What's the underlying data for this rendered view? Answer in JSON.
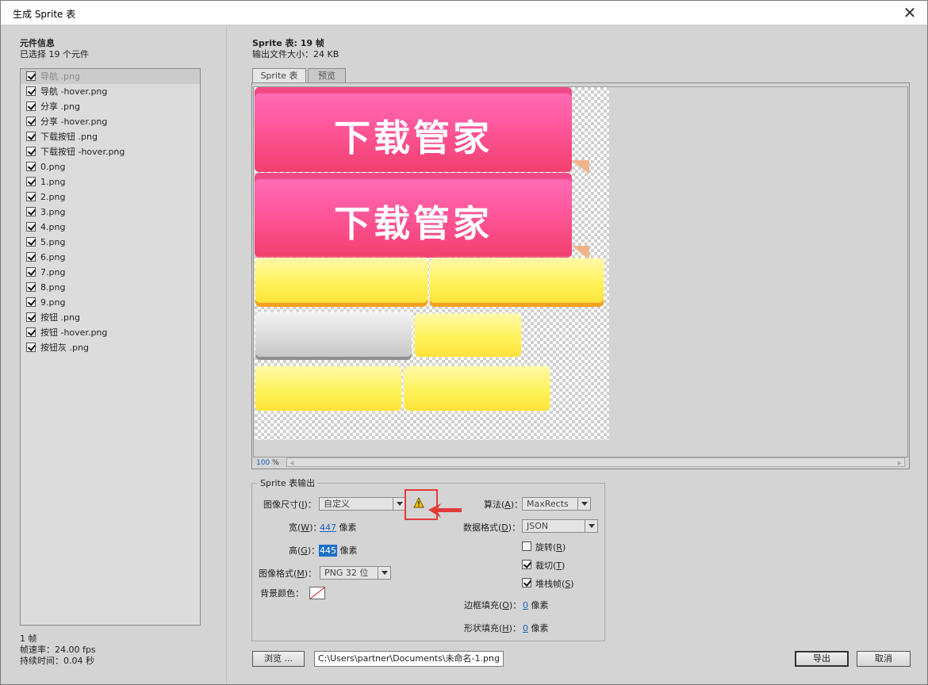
{
  "window": {
    "title": "生成 Sprite 表",
    "close_label": "✕"
  },
  "left": {
    "heading": "元件信息",
    "selected_count": "已选择 19 个元件",
    "items": [
      {
        "label": "导航 .png",
        "checked": true
      },
      {
        "label": "导航 -hover.png",
        "checked": true
      },
      {
        "label": "分享 .png",
        "checked": true
      },
      {
        "label": "分享 -hover.png",
        "checked": true
      },
      {
        "label": "下载按钮 .png",
        "checked": true
      },
      {
        "label": "下载按钮 -hover.png",
        "checked": true
      },
      {
        "label": "0.png",
        "checked": true
      },
      {
        "label": "1.png",
        "checked": true
      },
      {
        "label": "2.png",
        "checked": true
      },
      {
        "label": "3.png",
        "checked": true
      },
      {
        "label": "4.png",
        "checked": true
      },
      {
        "label": "5.png",
        "checked": true
      },
      {
        "label": "6.png",
        "checked": true
      },
      {
        "label": "7.png",
        "checked": true
      },
      {
        "label": "8.png",
        "checked": true
      },
      {
        "label": "9.png",
        "checked": true
      },
      {
        "label": "按钮 .png",
        "checked": true
      },
      {
        "label": "按钮 -hover.png",
        "checked": true
      },
      {
        "label": "按钮灰 .png",
        "checked": true
      }
    ],
    "stats": {
      "frames": "1 帧",
      "fps": "帧速率：24.00 fps",
      "duration": "持续时间：0.04 秒"
    }
  },
  "sprite": {
    "title": "Sprite 表: 19 帧",
    "file_size": "输出文件大小：24 KB",
    "tabs": [
      {
        "label": "Sprite 表",
        "active": true
      },
      {
        "label": "预览",
        "active": false
      }
    ],
    "preview_text": "下载管家",
    "zoom_value": "100",
    "zoom_unit": "%"
  },
  "output": {
    "group_title": "Sprite 表输出",
    "image_size": {
      "label_pre": "图像尺寸(",
      "key": "I",
      "label_post": ")：",
      "value": "自定义"
    },
    "width": {
      "label_pre": "宽(",
      "key": "W",
      "label_post": ")：",
      "value": "447",
      "unit": "像素"
    },
    "height": {
      "label_pre": "高(",
      "key": "G",
      "label_post": ")：",
      "value": "445",
      "unit": "像素"
    },
    "image_format": {
      "label_pre": "图像格式(",
      "key": "M",
      "label_post": ")：",
      "value": "PNG 32 位"
    },
    "bg_color": {
      "label": "背景颜色："
    },
    "algorithm": {
      "label_pre": "算法(",
      "key": "A",
      "label_post": ")：",
      "value": "MaxRects"
    },
    "data_format": {
      "label_pre": "数据格式(",
      "key": "D",
      "label_post": ")：",
      "value": "JSON"
    },
    "rotate": {
      "label_pre": "旋转(",
      "key": "R",
      "label_post": ")",
      "checked": false
    },
    "trim": {
      "label_pre": "裁切(",
      "key": "T",
      "label_post": ")",
      "checked": true
    },
    "stack": {
      "label_pre": "堆栈帧(",
      "key": "S",
      "label_post": ")",
      "checked": true
    },
    "border_padding": {
      "label_pre": "边框填充(",
      "key": "O",
      "label_post": ")：",
      "value": "0",
      "unit": "像素"
    },
    "shape_padding": {
      "label_pre": "形状填充(",
      "key": "H",
      "label_post": ")：",
      "value": "0",
      "unit": "像素"
    }
  },
  "footer": {
    "browse_label": "浏览 ...",
    "path_value": "C:\\Users\\partner\\Documents\\未命名-1.png",
    "export_label": "导出",
    "cancel_label": "取消"
  },
  "colors": {
    "accent_link": "#1b5fc1",
    "warning_border": "#e23b3b",
    "pink_button": "#f23f6d",
    "yellow_button": "#fff35a"
  },
  "icons": {
    "warning": "warning-triangle-icon",
    "arrow": "red-arrow-left-icon"
  }
}
